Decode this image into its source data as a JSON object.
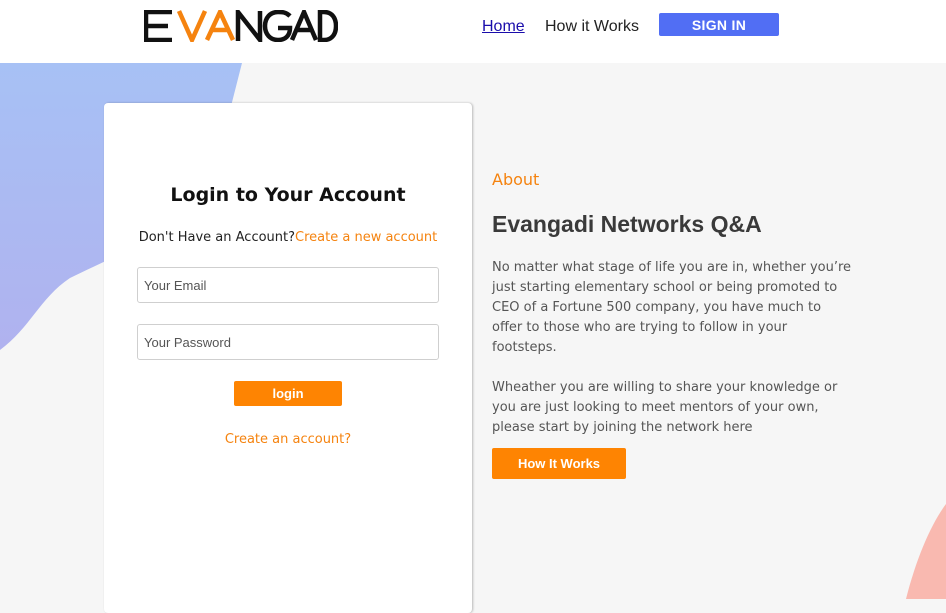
{
  "header": {
    "logo_alt": "EVANGADI",
    "nav": {
      "home": "Home",
      "how_it_works": "How it Works"
    },
    "signin_label": "SIGN IN"
  },
  "login": {
    "title": "Login to Your Account",
    "no_account_text": "Don't Have an Account?",
    "create_new_link": "Create a new account",
    "email_placeholder": "Your Email",
    "password_placeholder": "Your Password",
    "login_button": "login",
    "create_account_link": "Create an account?"
  },
  "about": {
    "label": "About",
    "title": "Evangadi Networks Q&A",
    "paragraph1": "No matter what stage of life you are in, whether you’re just starting elementary school or being promoted to CEO of a Fortune 500 company, you have much to offer to those who are trying to follow in your footsteps.",
    "paragraph2": "Wheather you are willing to share your knowledge or you are just looking to meet mentors of your own, please start by joining the network here",
    "button": "How It Works"
  },
  "colors": {
    "accent": "#fe8402",
    "signin": "#516ef4",
    "blob": "#a9b8f4",
    "pink": "#f9b9b0"
  }
}
